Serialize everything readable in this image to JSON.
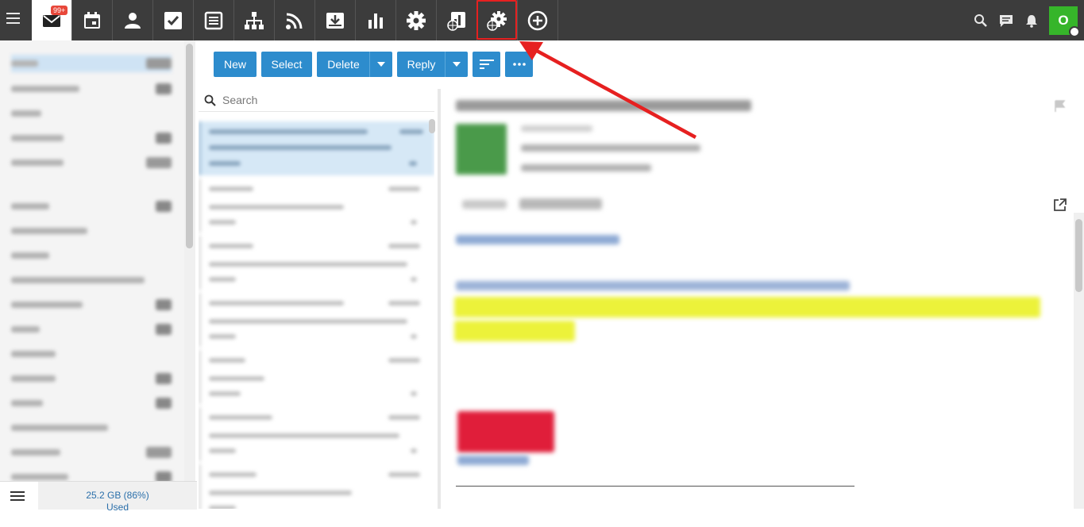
{
  "topbar": {
    "menu_icon": "hamburger-icon",
    "apps": [
      {
        "name": "mail",
        "icon": "envelope-icon",
        "badge": "99+",
        "active": true
      },
      {
        "name": "calendar",
        "icon": "calendar-icon"
      },
      {
        "name": "contacts",
        "icon": "person-icon"
      },
      {
        "name": "tasks",
        "icon": "checkbox-icon"
      },
      {
        "name": "notes",
        "icon": "document-icon"
      },
      {
        "name": "org-chart",
        "icon": "sitemap-icon"
      },
      {
        "name": "rss",
        "icon": "rss-icon"
      },
      {
        "name": "inbox-download",
        "icon": "tray-download-icon"
      },
      {
        "name": "reports",
        "icon": "bar-chart-icon"
      },
      {
        "name": "settings",
        "icon": "gear-icon"
      },
      {
        "name": "domain-reports",
        "icon": "report-globe-icon"
      },
      {
        "name": "domain-settings",
        "icon": "gear-globe-icon",
        "highlighted": true
      },
      {
        "name": "add-app",
        "icon": "plus-circle-icon"
      }
    ],
    "right_icons": [
      "search-icon",
      "chat-icon",
      "bell-icon"
    ],
    "avatar_letter": "O",
    "avatar_color": "#36b52a",
    "highlight_color": "#e62020"
  },
  "toolbar": {
    "new_label": "New",
    "select_label": "Select",
    "delete_label": "Delete",
    "reply_label": "Reply",
    "sort_icon": "sort-lines-icon",
    "more_icon": "ellipsis-icon",
    "accent": "#2d8ccd"
  },
  "search": {
    "placeholder": "Search"
  },
  "footer": {
    "quota_line1": "25.2 GB (86%)",
    "quota_line2": "Used"
  }
}
